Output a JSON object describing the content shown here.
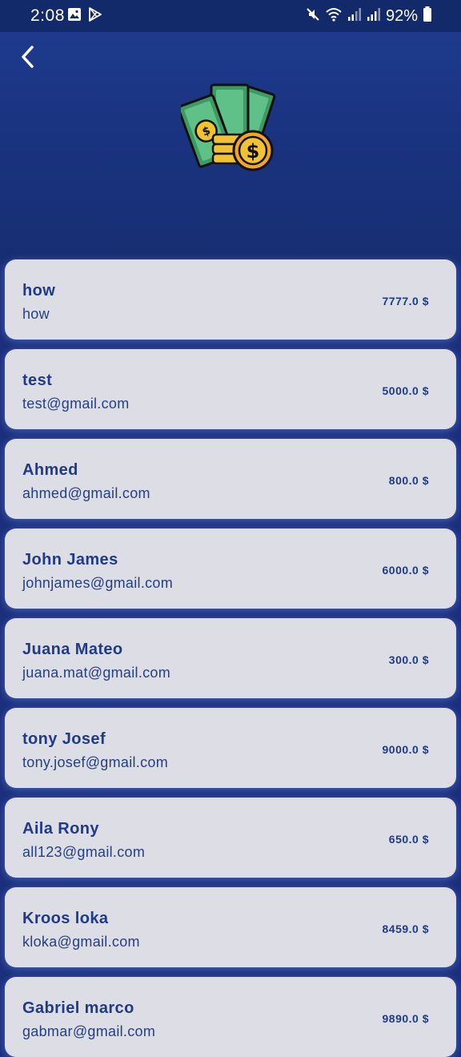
{
  "status_bar": {
    "time": "2:08",
    "battery_text": "92%",
    "icons": [
      "gallery-icon",
      "play-store-icon",
      "mute-icon",
      "wifi-icon",
      "signal-icon",
      "signal-icon",
      "battery-icon"
    ]
  },
  "header": {
    "back_icon": "chevron-left-icon",
    "logo_icon": "money-cash-coin-icon"
  },
  "accounts": [
    {
      "name": "how",
      "email": "how",
      "amount": "7777.0 $"
    },
    {
      "name": "test",
      "email": "test@gmail.com",
      "amount": "5000.0 $"
    },
    {
      "name": "Ahmed",
      "email": "ahmed@gmail.com",
      "amount": "800.0 $"
    },
    {
      "name": "John James",
      "email": "johnjames@gmail.com",
      "amount": "6000.0 $"
    },
    {
      "name": "Juana Mateo",
      "email": "juana.mat@gmail.com",
      "amount": "300.0 $"
    },
    {
      "name": "tony Josef",
      "email": "tony.josef@gmail.com",
      "amount": "9000.0 $"
    },
    {
      "name": "Aila Rony",
      "email": "all123@gmail.com",
      "amount": "650.0 $"
    },
    {
      "name": "Kroos loka",
      "email": "kloka@gmail.com",
      "amount": "8459.0 $"
    },
    {
      "name": "Gabriel marco",
      "email": "gabmar@gmail.com",
      "amount": "9890.0 $"
    }
  ],
  "colors": {
    "background": "#1b2f7d",
    "card": "#dcdde5",
    "text_primary": "#1f3a86"
  }
}
